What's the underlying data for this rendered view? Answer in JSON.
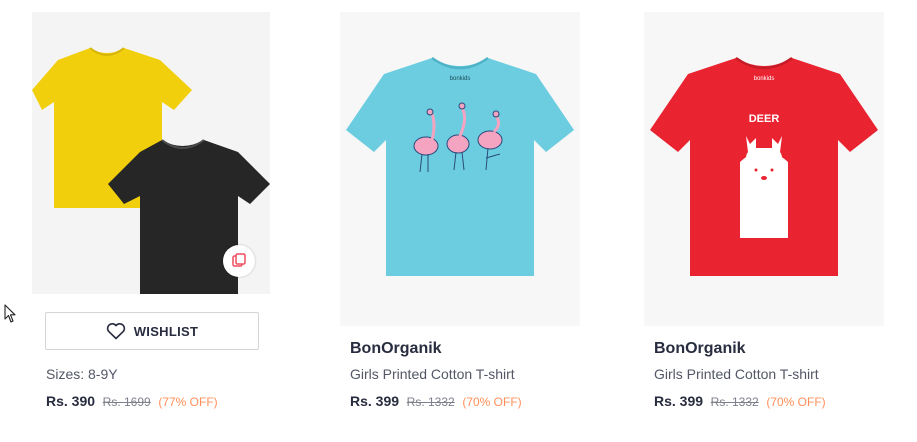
{
  "products": [
    {
      "images_alt": "Yellow and black plain t-shirts",
      "wishlist_label": "WISHLIST",
      "sizes_label": "Sizes: 8-9Y",
      "price": "Rs. 390",
      "mrp": "Rs. 1699",
      "discount": "(77% OFF)"
    },
    {
      "brand": "BonOrganik",
      "title": "Girls Printed Cotton T-shirt",
      "price": "Rs. 399",
      "mrp": "Rs. 1332",
      "discount": "(70% OFF)",
      "print_text": "bonkids"
    },
    {
      "brand": "BonOrganik",
      "title": "Girls Printed Cotton T-shirt",
      "price": "Rs. 399",
      "mrp": "Rs. 1332",
      "discount": "(70% OFF)",
      "print_text": "DEER"
    }
  ],
  "colors": {
    "discount": "#ff905a",
    "brand_text": "#282c3f",
    "muted_text": "#535766",
    "tshirt_yellow": "#f2cf0c",
    "tshirt_black": "#262626",
    "tshirt_blue": "#6ccde0",
    "tshirt_red": "#ea2330",
    "similar_icon": "#ee4d5d"
  },
  "icons": {
    "wishlist": "heart-outline-icon",
    "similar": "view-similar-icon",
    "cursor": "mouse-pointer-icon"
  }
}
